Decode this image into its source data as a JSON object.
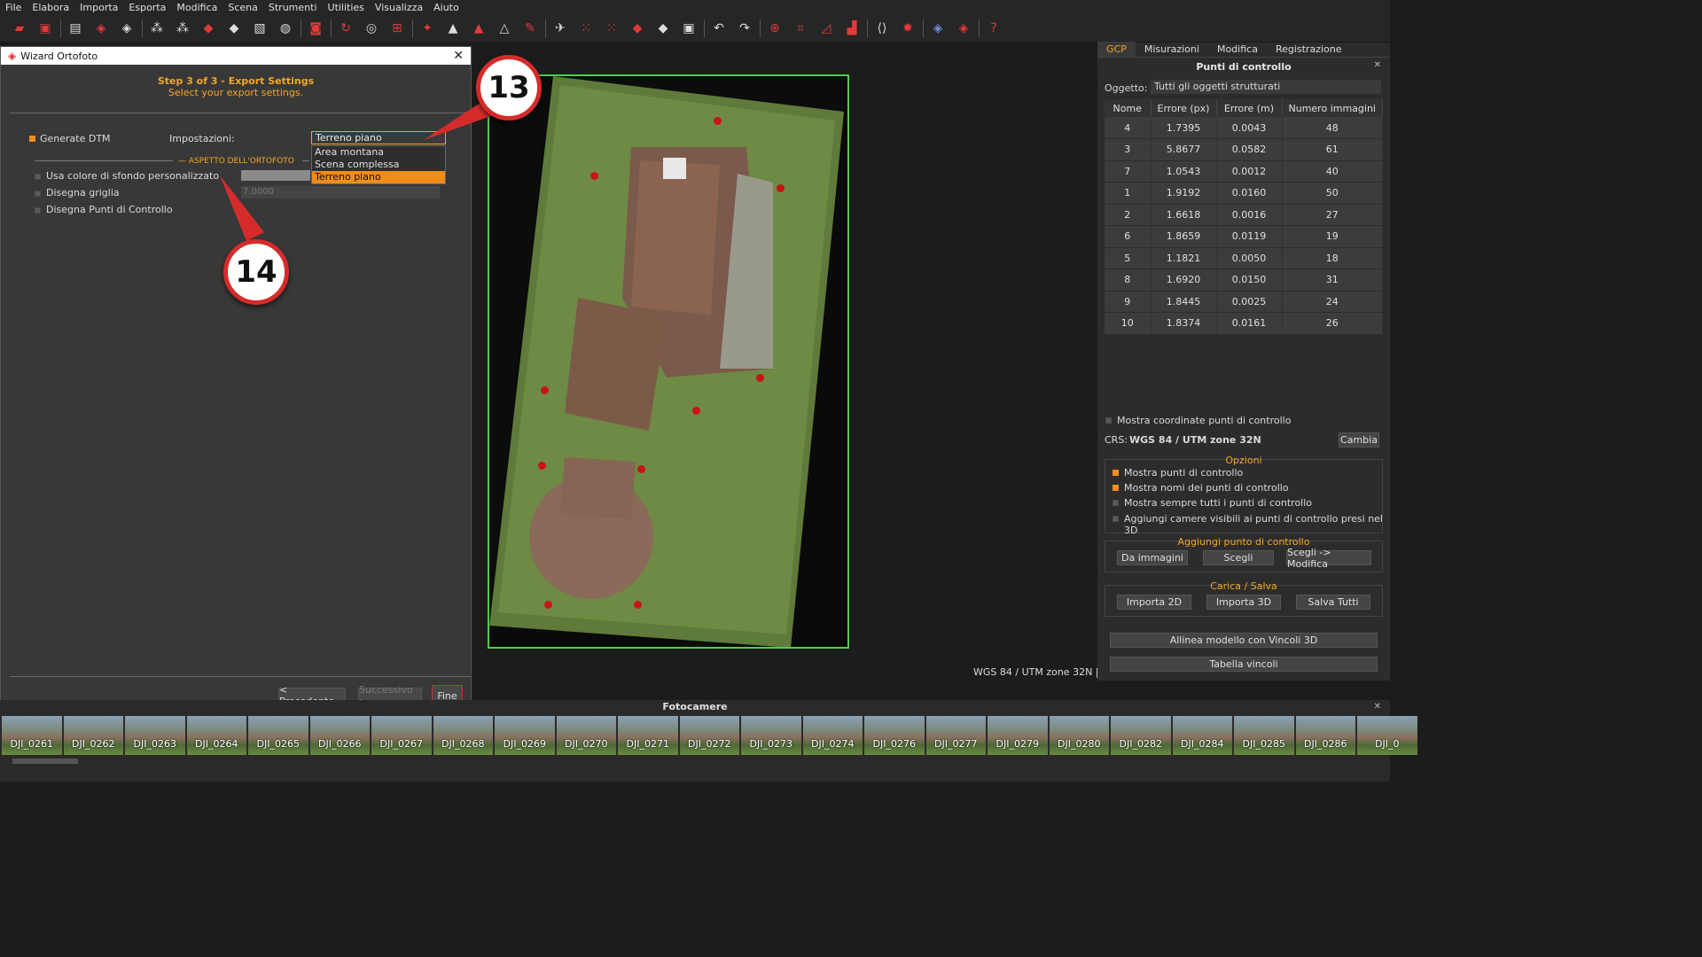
{
  "menu": [
    "File",
    "Elabora",
    "Importa",
    "Esporta",
    "Modifica",
    "Scena",
    "Strumenti",
    "Utilities",
    "Visualizza",
    "Aiuto"
  ],
  "wizard": {
    "title": "Wizard Ortofoto",
    "step": "Step 3 of 3 - Export Settings",
    "subtitle": "Select your export settings.",
    "generate_dtm": "Generate DTM",
    "settings_label": "Impostazioni:",
    "settings_value": "Terreno piano",
    "dropdown_options": [
      "Area montana",
      "Scena complessa",
      "Terreno piano"
    ],
    "section": "ASPETTO DELL'ORTOFOTO",
    "opt_bg": "Usa colore di sfondo personalizzato",
    "opt_grid": "Disegna griglia",
    "opt_points": "Disegna Punti di Controllo",
    "grid_value": "7.0000",
    "btn_prev": "< Precedente",
    "btn_next": "Successivo >",
    "btn_finish": "Fine"
  },
  "viewport": {
    "status": "WGS 84 / UTM zone 32N |"
  },
  "panel": {
    "tabs": [
      "GCP",
      "Misurazioni",
      "Modifica",
      "Registrazione"
    ],
    "title": "Punti di controllo",
    "object_label": "Oggetto:",
    "object_value": "Tutti gli oggetti strutturati",
    "columns": [
      "Nome",
      "Errore (px)",
      "Errore (m)",
      "Numero immagini"
    ],
    "rows": [
      [
        "4",
        "1.7395",
        "0.0043",
        "48"
      ],
      [
        "3",
        "5.8677",
        "0.0582",
        "61"
      ],
      [
        "7",
        "1.0543",
        "0.0012",
        "40"
      ],
      [
        "1",
        "1.9192",
        "0.0160",
        "50"
      ],
      [
        "2",
        "1.6618",
        "0.0016",
        "27"
      ],
      [
        "6",
        "1.8659",
        "0.0119",
        "19"
      ],
      [
        "5",
        "1.1821",
        "0.0050",
        "18"
      ],
      [
        "8",
        "1.6920",
        "0.0150",
        "31"
      ],
      [
        "9",
        "1.8445",
        "0.0025",
        "24"
      ],
      [
        "10",
        "1.8374",
        "0.0161",
        "26"
      ]
    ],
    "show_coords": "Mostra coordinate punti di controllo",
    "crs_label": "CRS:",
    "crs_value": "WGS 84 / UTM zone 32N",
    "crs_btn": "Cambia",
    "options_title": "Opzioni",
    "options": [
      "Mostra punti di controllo",
      "Mostra nomi dei punti di controllo",
      "Mostra sempre tutti i punti di controllo",
      "Aggiungi camere visibili ai punti di controllo presi nel 3D"
    ],
    "add_title": "Aggiungi punto di controllo",
    "add_btns": [
      "Da immagini",
      "Scegli",
      "Scegli -> Modifica"
    ],
    "load_title": "Carica / Salva",
    "load_btns": [
      "Importa 2D",
      "Importa 3D",
      "Salva Tutti"
    ],
    "align_btn": "Allinea modello con Vincoli 3D",
    "table_btn": "Tabella vincoli"
  },
  "cameras": {
    "title": "Fotocamere",
    "items": [
      "DJI_0261",
      "DJI_0262",
      "DJI_0263",
      "DJI_0264",
      "DJI_0265",
      "DJI_0266",
      "DJI_0267",
      "DJI_0268",
      "DJI_0269",
      "DJI_0270",
      "DJI_0271",
      "DJI_0272",
      "DJI_0273",
      "DJI_0274",
      "DJI_0276",
      "DJI_0277",
      "DJI_0279",
      "DJI_0280",
      "DJI_0282",
      "DJI_0284",
      "DJI_0285",
      "DJI_0286",
      "DJI_0"
    ]
  },
  "annotations": {
    "a13": "13",
    "a14": "14"
  }
}
